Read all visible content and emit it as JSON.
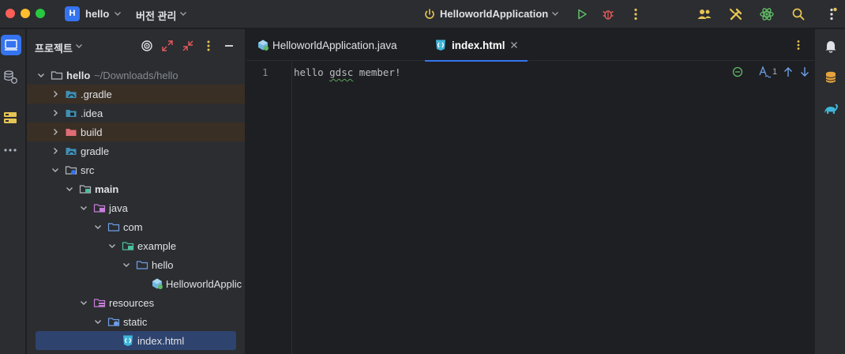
{
  "titlebar": {
    "project_badge": "H",
    "project_name": "hello",
    "vcs_label": "버전 관리",
    "run_config": "HelloworldApplication",
    "run_config_icon": "power-icon",
    "run_icon": "run-icon",
    "debug_icon": "debug-icon",
    "more_icon": "more-vertical-icon",
    "right_icons": [
      "code-with-me-icon",
      "build-tools-icon",
      "ai-assistant-icon",
      "search-icon",
      "settings-icon"
    ]
  },
  "left_strip": {
    "buttons": [
      "project-view-icon",
      "services-icon",
      "structure-icon",
      "more-tools-icon"
    ]
  },
  "project_panel": {
    "title": "프로젝트",
    "header_icons": [
      "locate-icon",
      "expand-all-icon",
      "collapse-all-icon",
      "options-icon",
      "hide-icon"
    ],
    "tree": [
      {
        "label": "hello",
        "sublabel": "~/Downloads/hello",
        "expanded": true,
        "icon": "folder-icon",
        "bold": true
      },
      {
        "label": ".gradle",
        "expanded": false,
        "icon": "gradle-folder-icon"
      },
      {
        "label": ".idea",
        "expanded": false,
        "icon": "idea-folder-icon"
      },
      {
        "label": "build",
        "expanded": false,
        "icon": "build-folder-icon"
      },
      {
        "label": "gradle",
        "expanded": false,
        "icon": "gradle-folder-icon"
      },
      {
        "label": "src",
        "expanded": true,
        "icon": "source-folder-icon"
      },
      {
        "label": "main",
        "expanded": true,
        "icon": "module-folder-icon",
        "bold": true
      },
      {
        "label": "java",
        "expanded": true,
        "icon": "java-source-folder-icon"
      },
      {
        "label": "com",
        "expanded": true,
        "icon": "package-icon"
      },
      {
        "label": "example",
        "expanded": true,
        "icon": "package-icon"
      },
      {
        "label": "hello",
        "expanded": true,
        "icon": "package-icon"
      },
      {
        "label": "HelloworldApplic",
        "icon": "spring-class-icon"
      },
      {
        "label": "resources",
        "expanded": true,
        "icon": "resources-folder-icon"
      },
      {
        "label": "static",
        "expanded": true,
        "icon": "web-folder-icon"
      },
      {
        "label": "index.html",
        "icon": "html-file-icon",
        "selected": true
      }
    ]
  },
  "editor": {
    "tabs": [
      {
        "label": "HelloworldApplication.java",
        "icon": "spring-class-icon",
        "active": false
      },
      {
        "label": "index.html",
        "icon": "html-file-icon",
        "active": true,
        "close_icon": "close-icon"
      }
    ],
    "tabbar_more_icon": "more-vertical-icon",
    "line_numbers": [
      "1"
    ],
    "code": {
      "before": "hello ",
      "squiggle": "gdsc",
      "after": " member!"
    },
    "inspections": {
      "status_icon": "no-errors-icon",
      "typo_count": "1",
      "typo_icon": "typo-icon",
      "prev_icon": "arrow-up-icon",
      "next_icon": "arrow-down-icon"
    }
  },
  "right_strip": {
    "buttons": [
      "notifications-icon",
      "database-icon",
      "gradle-icon"
    ]
  },
  "colors": {
    "accent": "#3574f0",
    "panel_bg": "#2b2d30",
    "editor_bg": "#1e1f22",
    "selection": "#2e436e",
    "excluded_highlight": "#3a2f25"
  }
}
